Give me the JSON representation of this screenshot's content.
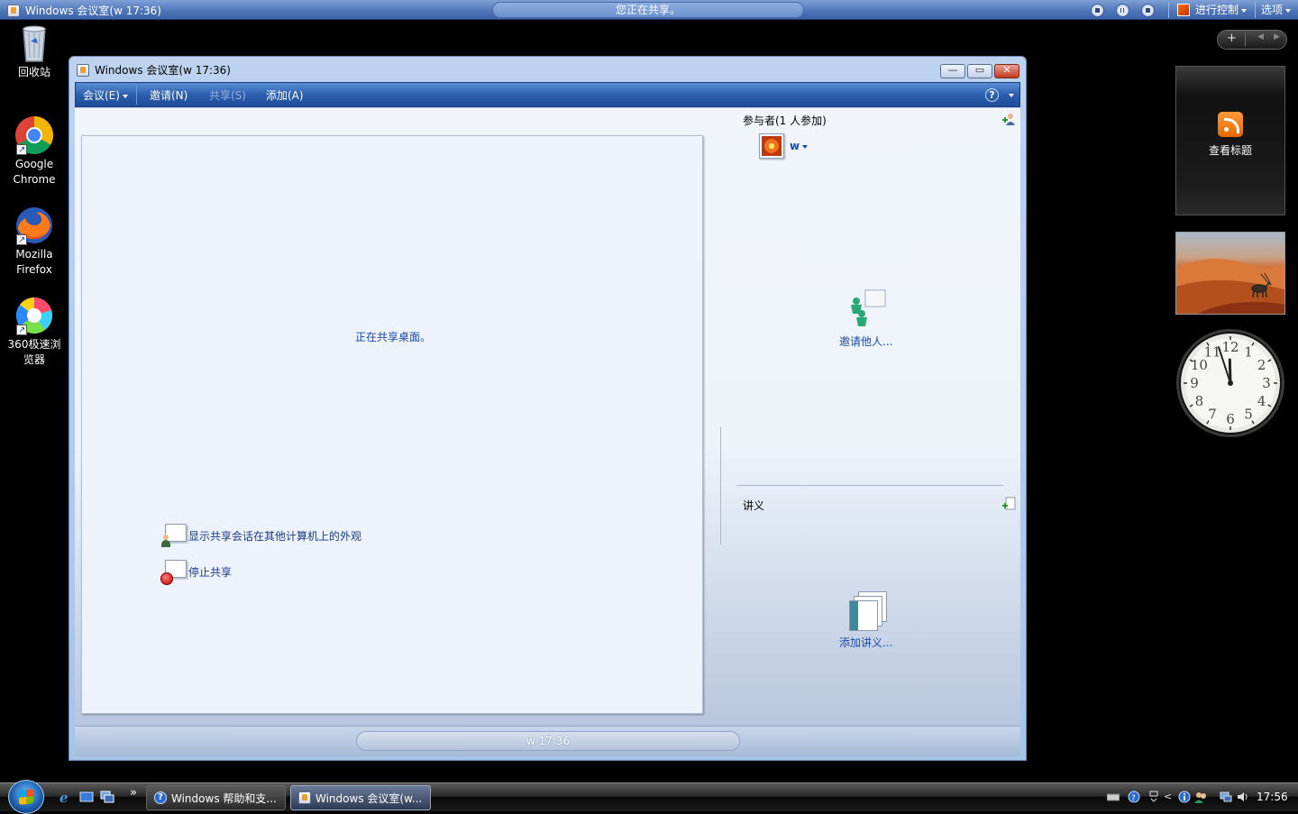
{
  "topbar": {
    "title": "Windows 会议室(w 17:36)",
    "status": "您正在共享。",
    "control_menu": "进行控制",
    "options_menu": "选项"
  },
  "desktop_icons": [
    {
      "label": "回收站"
    },
    {
      "label": "Google Chrome"
    },
    {
      "label": "Mozilla Firefox"
    },
    {
      "label": "360极速浏览器"
    }
  ],
  "gadgets": {
    "sidebar_add": "+",
    "rss_label": "查看标题"
  },
  "window": {
    "title": "Windows 会议室(w 17:36)",
    "menus": [
      {
        "label": "会议(E)"
      },
      {
        "label": "邀请(N)"
      },
      {
        "label": "共享(S)"
      },
      {
        "label": "添加(A)"
      }
    ],
    "help": "?",
    "share_panel": {
      "message": "正在共享桌面。",
      "actions": [
        {
          "label": "显示共享会话在其他计算机上的外观"
        },
        {
          "label": "停止共享"
        }
      ]
    },
    "participants": {
      "label": "参与者(1 人参加)",
      "items": [
        {
          "name": "w"
        }
      ],
      "invite_label": "邀请他人..."
    },
    "handouts": {
      "label": "讲义",
      "add_label": "添加讲义..."
    },
    "status": "w 17:36"
  },
  "taskbar": {
    "more": "»",
    "buttons": [
      {
        "label": "Windows 帮助和支..."
      },
      {
        "label": "Windows 会议室(w..."
      }
    ],
    "clock": "17:56"
  },
  "colors": {
    "accent": "#1e4c98",
    "link": "#1a4aa8",
    "stop": "#c00000"
  }
}
